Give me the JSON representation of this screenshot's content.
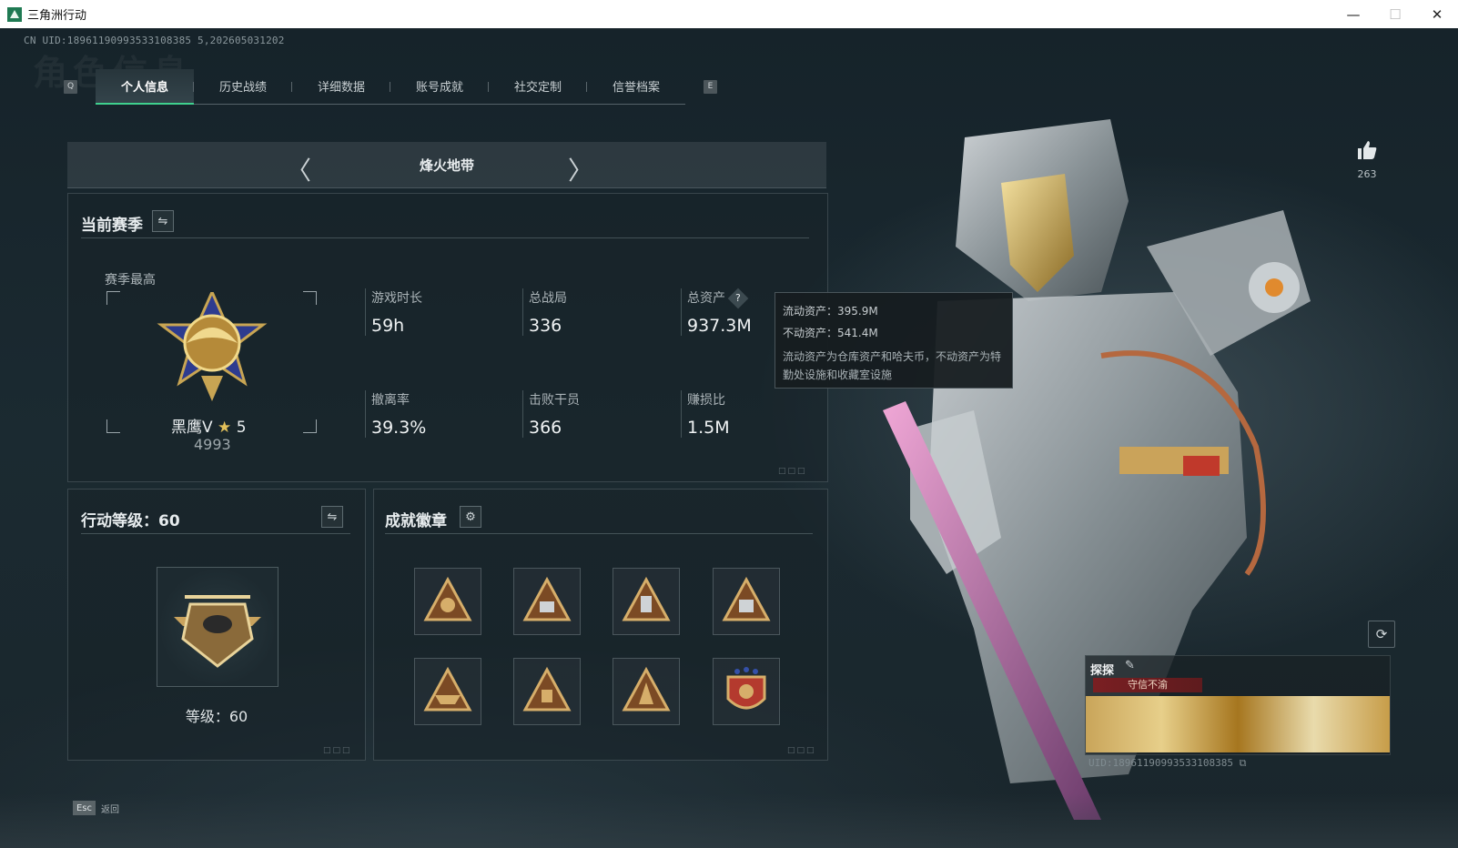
{
  "window": {
    "title": "三角洲行动",
    "min": "—",
    "max": "☐",
    "close": "✕"
  },
  "uid_text": "CN UID:18961190993533108385 5,202605031202",
  "watermark": "角色信息",
  "tabs": {
    "prev_key": "Q",
    "next_key": "E",
    "items": [
      {
        "label": "个人信息",
        "active": true
      },
      {
        "label": "历史战绩",
        "active": false
      },
      {
        "label": "详细数据",
        "active": false
      },
      {
        "label": "账号成就",
        "active": false
      },
      {
        "label": "社交定制",
        "active": false
      },
      {
        "label": "信誉档案",
        "active": false
      }
    ]
  },
  "mode": {
    "title": "烽火地带",
    "prev": "〈",
    "next": "〉"
  },
  "season": {
    "header": "当前赛季",
    "swap_icon": "⇋",
    "best_label": "赛季最高",
    "rank_name": "黑鹰V",
    "rank_star": "★",
    "rank_stars_count": "5",
    "rank_score": "4993",
    "stats": [
      {
        "label": "游戏时长",
        "value": "59h"
      },
      {
        "label": "总战局",
        "value": "336"
      },
      {
        "label": "总资产",
        "value": "937.3M",
        "help": "?"
      },
      {
        "label": "撤离率",
        "value": "39.3%"
      },
      {
        "label": "击败干员",
        "value": "366"
      },
      {
        "label": "赚损比",
        "value": "1.5M"
      }
    ]
  },
  "tooltip": {
    "liquid": "流动资产：395.9M",
    "fixed": "不动资产：541.4M",
    "desc": "流动资产为仓库资产和哈夫币，不动资产为特勤处设施和收藏室设施"
  },
  "level": {
    "header": "行动等级：60",
    "swap_icon": "⇋",
    "level_text": "等级：60"
  },
  "badges": {
    "header": "成就徽章",
    "gear_icon": "⚙",
    "count": 8
  },
  "likes": {
    "count": "263"
  },
  "card": {
    "name": "探探",
    "edit_icon": "✎",
    "tag": "守信不渝",
    "uid": "UID:18961190993533108385 ⧉"
  },
  "footer": {
    "esc_key": "Esc",
    "back_label": "返回"
  },
  "refresh_icon": "⟳",
  "colors": {
    "accent": "#3fd08e",
    "panel_border": "#78878c",
    "tag": "#7a1f22"
  }
}
